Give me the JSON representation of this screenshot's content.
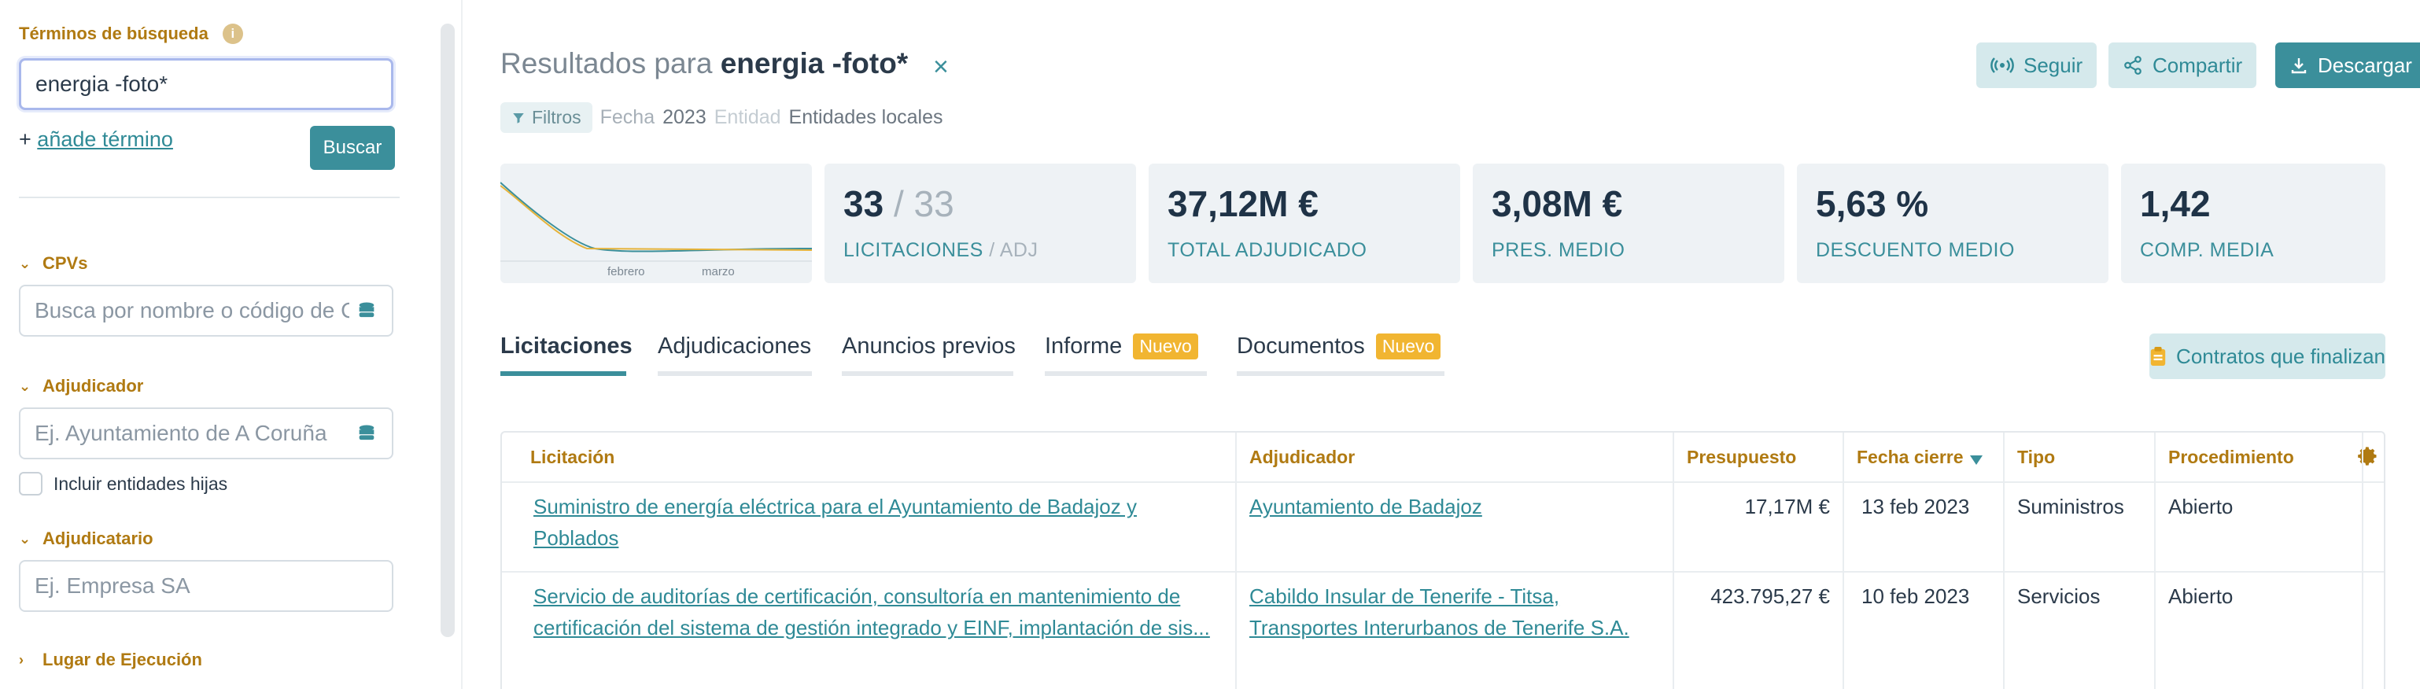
{
  "sidebar": {
    "search_terms_heading": "Términos de búsqueda",
    "info_icon": "i",
    "search_value": "energia -foto*",
    "add_prefix": "+",
    "add_term_link": "añade término",
    "search_button": "Buscar",
    "cpvs_heading": "CPVs",
    "cpvs_placeholder": "Busca por nombre o código de CPV",
    "adjudicador_heading": "Adjudicador",
    "adjudicador_placeholder": "Ej. Ayuntamiento de A Coruña",
    "include_children_label": "Incluir entidades hijas",
    "adjudicatario_heading": "Adjudicatario",
    "adjudicatario_placeholder": "Ej. Empresa SA",
    "lugar_heading": "Lugar de Ejecución"
  },
  "header": {
    "results_prefix": "Resultados para",
    "query": "energia -foto*",
    "close_icon": "×",
    "filters_label": "Filtros",
    "fecha_label": "Fecha",
    "fecha_value": "2023",
    "entidad_label": "Entidad",
    "entidad_value": "Entidades locales",
    "follow_button": "Seguir",
    "share_button": "Compartir",
    "download_button": "Descargar"
  },
  "stats": {
    "sparkline_labels": [
      "febrero",
      "marzo"
    ],
    "licitaciones_count": "33",
    "adj_count": "/ 33",
    "licitaciones_label": "LICITACIONES",
    "adj_label": "/ ADJ",
    "total_adjudicado": "37,12M €",
    "total_adjudicado_label": "TOTAL ADJUDICADO",
    "pres_medio": "3,08M €",
    "pres_medio_label": "PRES. MEDIO",
    "descuento_medio": "5,63 %",
    "descuento_medio_label": "DESCUENTO MEDIO",
    "comp_media": "1,42",
    "comp_media_label": "COMP. MEDIA"
  },
  "tabs": [
    {
      "label": "Licitaciones",
      "badge": ""
    },
    {
      "label": "Adjudicaciones",
      "badge": ""
    },
    {
      "label": "Anuncios previos",
      "badge": ""
    },
    {
      "label": "Informe",
      "badge": "Nuevo"
    },
    {
      "label": "Documentos",
      "badge": "Nuevo"
    }
  ],
  "contracts_button": "Contratos que finalizan",
  "table": {
    "headers": [
      "Licitación",
      "Adjudicador",
      "Presupuesto",
      "Fecha cierre",
      "Tipo",
      "Procedimiento"
    ],
    "rows": [
      {
        "licitacion": "Suministro de energía eléctrica para el Ayuntamiento de Badajoz y Poblados",
        "adjudicador": "Ayuntamiento de Badajoz",
        "presupuesto": "17,17M €",
        "fecha": "13 feb 2023",
        "tipo": "Suministros",
        "procedimiento": "Abierto"
      },
      {
        "licitacion": "Servicio de auditorías de certificación, consultoría en mantenimiento de certificación del sistema de gestión integrado y EINF, implantación de sis...",
        "adjudicador": "Cabildo Insular de Tenerife - Titsa, Transportes Interurbanos de Tenerife S.A.",
        "presupuesto": "423.795,27 €",
        "fecha": "10 feb 2023",
        "tipo": "Servicios",
        "procedimiento": "Abierto"
      }
    ]
  },
  "colors": {
    "accent": "#3b8f9b",
    "heading_gold": "#b07a12",
    "badge_yellow": "#f1b531",
    "card_bg": "#eef2f5"
  }
}
